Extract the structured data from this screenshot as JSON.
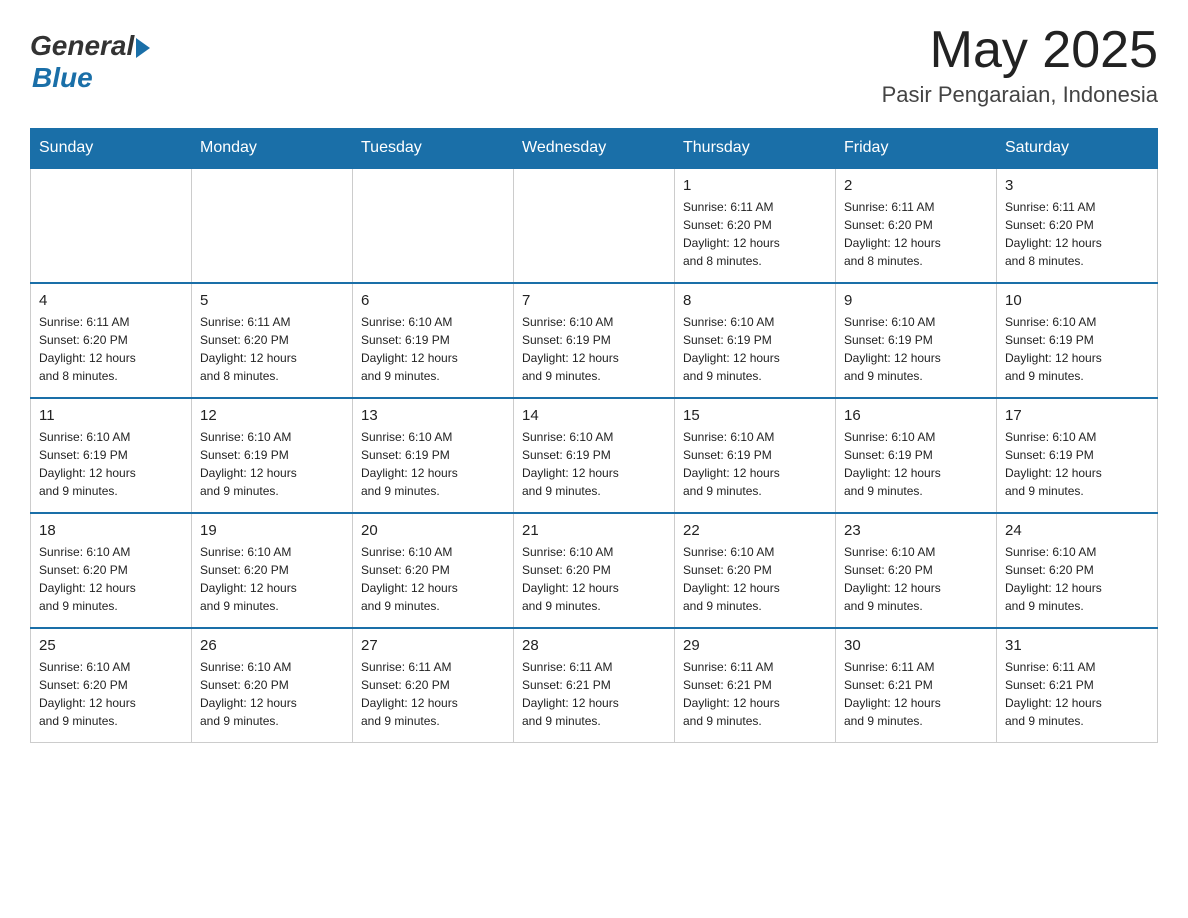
{
  "logo": {
    "general": "General",
    "blue": "Blue"
  },
  "title": "May 2025",
  "location": "Pasir Pengaraian, Indonesia",
  "headers": [
    "Sunday",
    "Monday",
    "Tuesday",
    "Wednesday",
    "Thursday",
    "Friday",
    "Saturday"
  ],
  "weeks": [
    [
      {
        "day": "",
        "info": ""
      },
      {
        "day": "",
        "info": ""
      },
      {
        "day": "",
        "info": ""
      },
      {
        "day": "",
        "info": ""
      },
      {
        "day": "1",
        "info": "Sunrise: 6:11 AM\nSunset: 6:20 PM\nDaylight: 12 hours\nand 8 minutes."
      },
      {
        "day": "2",
        "info": "Sunrise: 6:11 AM\nSunset: 6:20 PM\nDaylight: 12 hours\nand 8 minutes."
      },
      {
        "day": "3",
        "info": "Sunrise: 6:11 AM\nSunset: 6:20 PM\nDaylight: 12 hours\nand 8 minutes."
      }
    ],
    [
      {
        "day": "4",
        "info": "Sunrise: 6:11 AM\nSunset: 6:20 PM\nDaylight: 12 hours\nand 8 minutes."
      },
      {
        "day": "5",
        "info": "Sunrise: 6:11 AM\nSunset: 6:20 PM\nDaylight: 12 hours\nand 8 minutes."
      },
      {
        "day": "6",
        "info": "Sunrise: 6:10 AM\nSunset: 6:19 PM\nDaylight: 12 hours\nand 9 minutes."
      },
      {
        "day": "7",
        "info": "Sunrise: 6:10 AM\nSunset: 6:19 PM\nDaylight: 12 hours\nand 9 minutes."
      },
      {
        "day": "8",
        "info": "Sunrise: 6:10 AM\nSunset: 6:19 PM\nDaylight: 12 hours\nand 9 minutes."
      },
      {
        "day": "9",
        "info": "Sunrise: 6:10 AM\nSunset: 6:19 PM\nDaylight: 12 hours\nand 9 minutes."
      },
      {
        "day": "10",
        "info": "Sunrise: 6:10 AM\nSunset: 6:19 PM\nDaylight: 12 hours\nand 9 minutes."
      }
    ],
    [
      {
        "day": "11",
        "info": "Sunrise: 6:10 AM\nSunset: 6:19 PM\nDaylight: 12 hours\nand 9 minutes."
      },
      {
        "day": "12",
        "info": "Sunrise: 6:10 AM\nSunset: 6:19 PM\nDaylight: 12 hours\nand 9 minutes."
      },
      {
        "day": "13",
        "info": "Sunrise: 6:10 AM\nSunset: 6:19 PM\nDaylight: 12 hours\nand 9 minutes."
      },
      {
        "day": "14",
        "info": "Sunrise: 6:10 AM\nSunset: 6:19 PM\nDaylight: 12 hours\nand 9 minutes."
      },
      {
        "day": "15",
        "info": "Sunrise: 6:10 AM\nSunset: 6:19 PM\nDaylight: 12 hours\nand 9 minutes."
      },
      {
        "day": "16",
        "info": "Sunrise: 6:10 AM\nSunset: 6:19 PM\nDaylight: 12 hours\nand 9 minutes."
      },
      {
        "day": "17",
        "info": "Sunrise: 6:10 AM\nSunset: 6:19 PM\nDaylight: 12 hours\nand 9 minutes."
      }
    ],
    [
      {
        "day": "18",
        "info": "Sunrise: 6:10 AM\nSunset: 6:20 PM\nDaylight: 12 hours\nand 9 minutes."
      },
      {
        "day": "19",
        "info": "Sunrise: 6:10 AM\nSunset: 6:20 PM\nDaylight: 12 hours\nand 9 minutes."
      },
      {
        "day": "20",
        "info": "Sunrise: 6:10 AM\nSunset: 6:20 PM\nDaylight: 12 hours\nand 9 minutes."
      },
      {
        "day": "21",
        "info": "Sunrise: 6:10 AM\nSunset: 6:20 PM\nDaylight: 12 hours\nand 9 minutes."
      },
      {
        "day": "22",
        "info": "Sunrise: 6:10 AM\nSunset: 6:20 PM\nDaylight: 12 hours\nand 9 minutes."
      },
      {
        "day": "23",
        "info": "Sunrise: 6:10 AM\nSunset: 6:20 PM\nDaylight: 12 hours\nand 9 minutes."
      },
      {
        "day": "24",
        "info": "Sunrise: 6:10 AM\nSunset: 6:20 PM\nDaylight: 12 hours\nand 9 minutes."
      }
    ],
    [
      {
        "day": "25",
        "info": "Sunrise: 6:10 AM\nSunset: 6:20 PM\nDaylight: 12 hours\nand 9 minutes."
      },
      {
        "day": "26",
        "info": "Sunrise: 6:10 AM\nSunset: 6:20 PM\nDaylight: 12 hours\nand 9 minutes."
      },
      {
        "day": "27",
        "info": "Sunrise: 6:11 AM\nSunset: 6:20 PM\nDaylight: 12 hours\nand 9 minutes."
      },
      {
        "day": "28",
        "info": "Sunrise: 6:11 AM\nSunset: 6:21 PM\nDaylight: 12 hours\nand 9 minutes."
      },
      {
        "day": "29",
        "info": "Sunrise: 6:11 AM\nSunset: 6:21 PM\nDaylight: 12 hours\nand 9 minutes."
      },
      {
        "day": "30",
        "info": "Sunrise: 6:11 AM\nSunset: 6:21 PM\nDaylight: 12 hours\nand 9 minutes."
      },
      {
        "day": "31",
        "info": "Sunrise: 6:11 AM\nSunset: 6:21 PM\nDaylight: 12 hours\nand 9 minutes."
      }
    ]
  ]
}
